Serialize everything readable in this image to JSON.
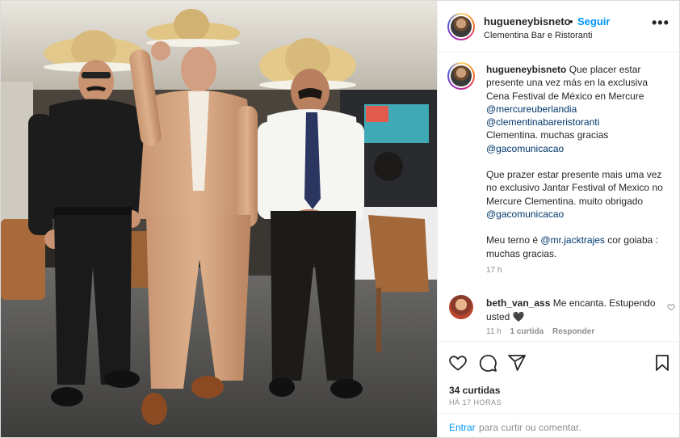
{
  "post": {
    "username": "hugueneybisneto",
    "separator": "•",
    "follow_label": "Seguir",
    "location": "Clementina Bar e Ristoranti",
    "more_label": "•••"
  },
  "caption": {
    "username": "hugueneybisneto",
    "line1_text": "Que placer estar presente una vez más en la exclusiva Cena Festival de México en Mercure",
    "mention1": "@mercureuberlandia",
    "mention2": "@clementinabareristoranti",
    "line2_text": "Clementina. muchas gracias",
    "mention3": "@gacomunicacao",
    "line3_text": "Que prazer estar presente mais uma vez no exclusivo Jantar Festival of Mexico no Mercure Clementina. muito obrigado",
    "mention4": "@gacomunicacao",
    "line4_text": "Meu terno é",
    "mention5": "@mr.jacktrajes",
    "line4_rest": "cor goiaba : muchas gracias.",
    "time": "17 h"
  },
  "comment": {
    "username": "beth_van_ass",
    "text": "Me encanta. Estupendo usted 🖤",
    "time": "11 h",
    "likes": "1 curtida",
    "reply_label": "Responder"
  },
  "stats": {
    "likes": "34 curtidas",
    "ago": "HÁ 17 HORAS"
  },
  "add_comment": {
    "login_label": "Entrar",
    "rest_text": "para curtir ou comentar."
  },
  "icons": {
    "like": "heart-icon",
    "comment": "comment-icon",
    "share": "paper-plane-icon",
    "save": "bookmark-icon",
    "options": "more-options-icon"
  },
  "colors": {
    "link_blue": "#0095f6",
    "mention_blue": "#00376b",
    "muted_gray": "#8e8e8e"
  }
}
